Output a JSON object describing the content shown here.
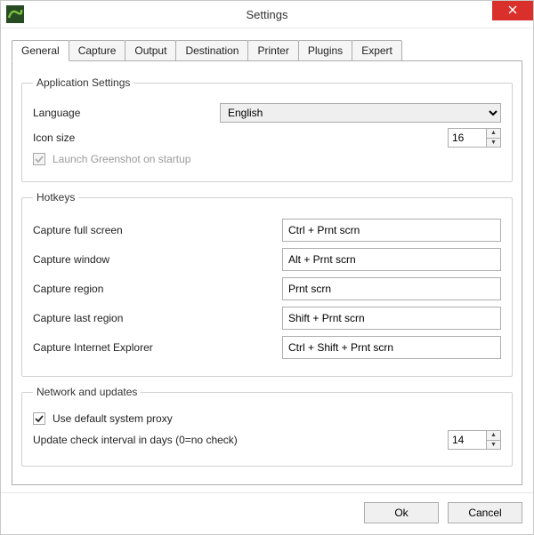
{
  "window": {
    "title": "Settings",
    "close_tooltip": "Close"
  },
  "tabs": {
    "general": "General",
    "capture": "Capture",
    "output": "Output",
    "destination": "Destination",
    "printer": "Printer",
    "plugins": "Plugins",
    "expert": "Expert"
  },
  "groups": {
    "app_settings": {
      "legend": "Application Settings",
      "language_label": "Language",
      "language_value": "English",
      "icon_size_label": "Icon size",
      "icon_size_value": "16",
      "launch_on_startup_label": "Launch Greenshot on startup",
      "launch_on_startup_checked": true,
      "launch_on_startup_disabled": true
    },
    "hotkeys": {
      "legend": "Hotkeys",
      "items": [
        {
          "label": "Capture full screen",
          "value": "Ctrl + Prnt scrn"
        },
        {
          "label": "Capture window",
          "value": "Alt + Prnt scrn"
        },
        {
          "label": "Capture region",
          "value": "Prnt scrn"
        },
        {
          "label": "Capture last region",
          "value": "Shift + Prnt scrn"
        },
        {
          "label": "Capture Internet Explorer",
          "value": "Ctrl + Shift + Prnt scrn"
        }
      ]
    },
    "network": {
      "legend": "Network and updates",
      "use_proxy_label": "Use default system proxy",
      "use_proxy_checked": true,
      "update_interval_label": "Update check interval in days (0=no check)",
      "update_interval_value": "14"
    }
  },
  "footer": {
    "ok": "Ok",
    "cancel": "Cancel"
  },
  "colors": {
    "close_bg": "#d9302c"
  }
}
